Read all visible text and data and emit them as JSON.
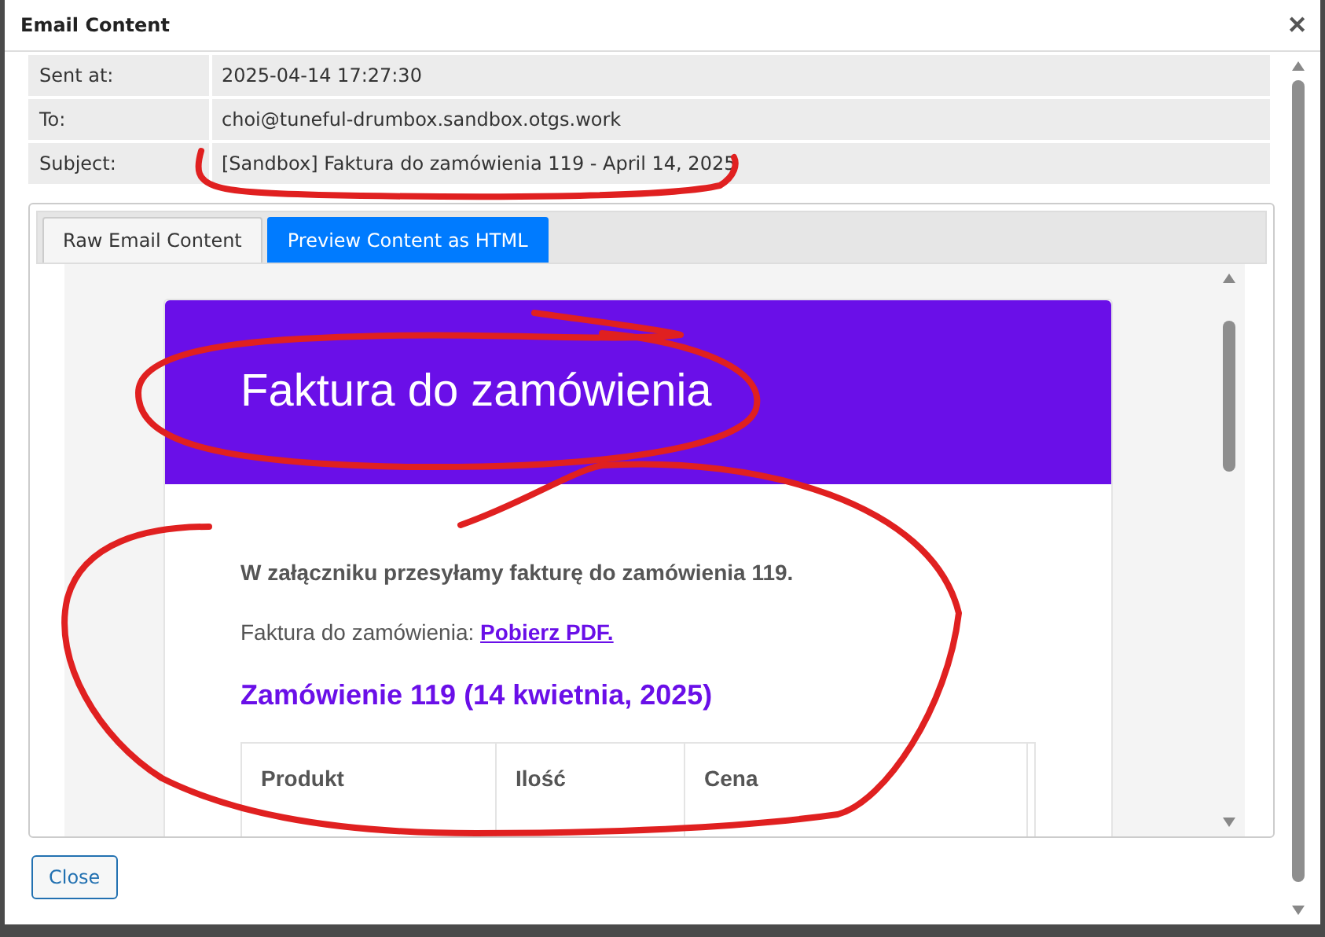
{
  "window": {
    "title": "Email Content",
    "close": "✕"
  },
  "fields": [
    {
      "label": "Sent at:",
      "value": "2025-04-14 17:27:30"
    },
    {
      "label": "To:",
      "value": "choi@tuneful-drumbox.sandbox.otgs.work"
    },
    {
      "label": "Subject:",
      "value": "[Sandbox] Faktura do zamówienia 119 - April 14, 2025"
    }
  ],
  "tabs": [
    {
      "label": "Raw Email Content",
      "selected": false
    },
    {
      "label": "Preview Content as HTML",
      "selected": true
    }
  ],
  "email": {
    "heading": "Faktura do zamówienia",
    "intro": "W załączniku przesyłamy fakturę do zamówienia 119.",
    "link_prefix": "Faktura do zamówienia:",
    "link": "Pobierz PDF.",
    "order_title": "Zamówienie 119 (14 kwietnia, 2025)",
    "columns": [
      "Produkt",
      "Ilość",
      "Cena"
    ]
  },
  "buttons": [
    "Close"
  ]
}
